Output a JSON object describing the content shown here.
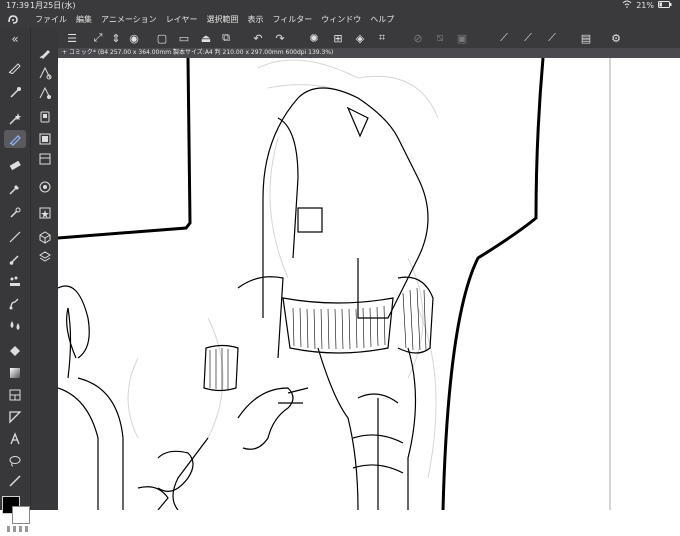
{
  "status": {
    "time": "17:39",
    "date": "1月25日(水)",
    "battery": "21%"
  },
  "menu": [
    "ファイル",
    "編集",
    "アニメーション",
    "レイヤー",
    "選択範囲",
    "表示",
    "フィルター",
    "ウィンドウ",
    "ヘルプ"
  ],
  "document_tab": {
    "title": "+ コミック* (B4 257.00 x 364.00mm 製本サイズ:A4 判 210.00 x 297.00mm 600dpi 139.3%)"
  },
  "colors": {
    "chrome": "#3a3a3c",
    "primary": "#000000",
    "secondary": "#ffffff"
  },
  "tools": [
    "pen-tool-icon",
    "eyedropper-icon",
    "wand-icon",
    "pen-nib-icon",
    "eraser-icon",
    "pipette-icon",
    "line-tool-icon",
    "brush-icon",
    "blend-icon",
    "fill-icon",
    "gradient-icon",
    "frame-icon",
    "shape-icon",
    "text-icon",
    "lasso-icon",
    "ruler-icon"
  ],
  "subtools": [
    "subtool-1",
    "subtool-2",
    "subtool-3",
    "subtool-4",
    "subtool-5",
    "subtool-6",
    "subtool-7",
    "subtool-8",
    "subtool-9",
    "subtool-10"
  ]
}
